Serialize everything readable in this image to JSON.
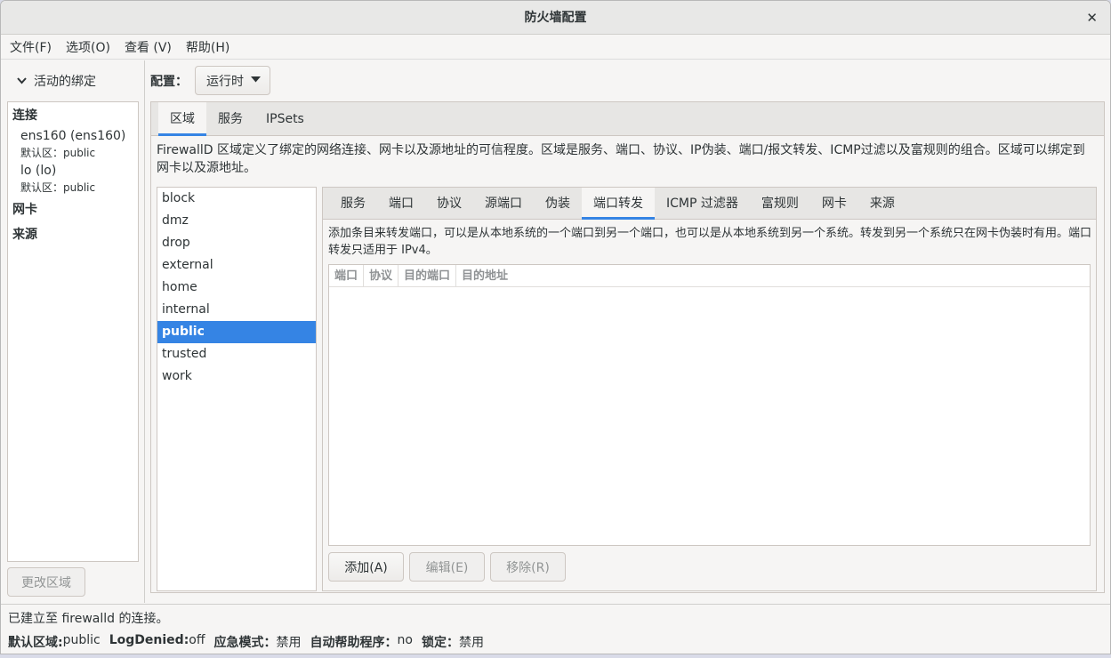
{
  "window": {
    "title": "防火墙配置",
    "close_glyph": "✕"
  },
  "menu": [
    {
      "label": "文件(F)"
    },
    {
      "label": "选项(O)"
    },
    {
      "label": "查看 (V)"
    },
    {
      "label": "帮助(H)"
    }
  ],
  "bindings": {
    "header": "活动的绑定",
    "connections_label": "连接",
    "connections": [
      {
        "name": "ens160 (ens160)",
        "zone": "默认区：public"
      },
      {
        "name": "lo (lo)",
        "zone": "默认区：public"
      }
    ],
    "interfaces_label": "网卡",
    "sources_label": "来源",
    "change_zone_label": "更改区域"
  },
  "config": {
    "label": "配置：",
    "value": "运行时"
  },
  "top_tabs": [
    {
      "label": "区域",
      "active": true
    },
    {
      "label": "服务",
      "active": false
    },
    {
      "label": "IPSets",
      "active": false
    }
  ],
  "zone_description": "FirewallD 区域定义了绑定的网络连接、网卡以及源地址的可信程度。区域是服务、端口、协议、IP伪装、端口/报文转发、ICMP过滤以及富规则的组合。区域可以绑定到网卡以及源地址。",
  "zones": [
    {
      "name": "block",
      "selected": false
    },
    {
      "name": "dmz",
      "selected": false
    },
    {
      "name": "drop",
      "selected": false
    },
    {
      "name": "external",
      "selected": false
    },
    {
      "name": "home",
      "selected": false
    },
    {
      "name": "internal",
      "selected": false
    },
    {
      "name": "public",
      "selected": true
    },
    {
      "name": "trusted",
      "selected": false
    },
    {
      "name": "work",
      "selected": false
    }
  ],
  "inner_tabs": [
    {
      "label": "服务",
      "active": false
    },
    {
      "label": "端口",
      "active": false
    },
    {
      "label": "协议",
      "active": false
    },
    {
      "label": "源端口",
      "active": false
    },
    {
      "label": "伪装",
      "active": false
    },
    {
      "label": "端口转发",
      "active": true
    },
    {
      "label": "ICMP 过滤器",
      "active": false
    },
    {
      "label": "富规则",
      "active": false
    },
    {
      "label": "网卡",
      "active": false
    },
    {
      "label": "来源",
      "active": false
    }
  ],
  "port_forward": {
    "description": "添加条目来转发端口，可以是从本地系统的一个端口到另一个端口，也可以是从本地系统到另一个系统。转发到另一个系统只在网卡伪装时有用。端口转发只适用于 IPv4。",
    "columns": [
      "端口",
      "协议",
      "目的端口",
      "目的地址"
    ],
    "buttons": [
      {
        "label": "添加(A)",
        "enabled": true
      },
      {
        "label": "编辑(E)",
        "enabled": false
      },
      {
        "label": "移除(R)",
        "enabled": false
      }
    ]
  },
  "status": {
    "connection": "已建立至 firewalld 的连接。",
    "items": [
      {
        "key": "默认区域:",
        "value": " public"
      },
      {
        "key": "LogDenied:",
        "value": " off"
      },
      {
        "key": "应急模式：",
        "value": " 禁用"
      },
      {
        "key": "自动帮助程序：",
        "value": " no"
      },
      {
        "key": "锁定：",
        "value": " 禁用"
      }
    ]
  }
}
